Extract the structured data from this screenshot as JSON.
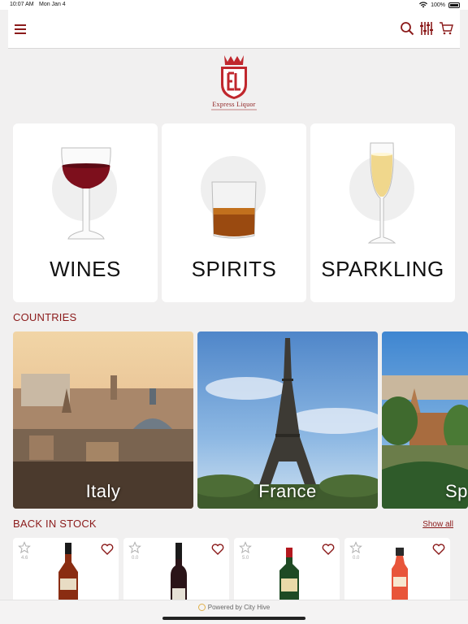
{
  "status": {
    "time": "10:07 AM",
    "date": "Mon Jan 4",
    "battery": "100%"
  },
  "header": {
    "menu_icon": "hamburger-icon",
    "icons": [
      "search-icon",
      "filter-icon",
      "cart-icon"
    ]
  },
  "logo": {
    "text": "Express Liquor"
  },
  "categories": [
    {
      "label": "WINES"
    },
    {
      "label": "SPIRITS"
    },
    {
      "label": "SPARKLING"
    }
  ],
  "countries": {
    "title": "COUNTRIES",
    "items": [
      {
        "name": "Italy"
      },
      {
        "name": "France"
      },
      {
        "name": "Sp"
      }
    ]
  },
  "back_in_stock": {
    "title": "BACK IN STOCK",
    "show_all": "Show all",
    "products": [
      {
        "rating": "4.6"
      },
      {
        "rating": "0.0"
      },
      {
        "rating": "5.0"
      },
      {
        "rating": "0.0"
      }
    ]
  },
  "footer": {
    "powered": "Powered by City Hive"
  },
  "colors": {
    "brand": "#8b1a1a",
    "background": "#f1f0f0"
  }
}
